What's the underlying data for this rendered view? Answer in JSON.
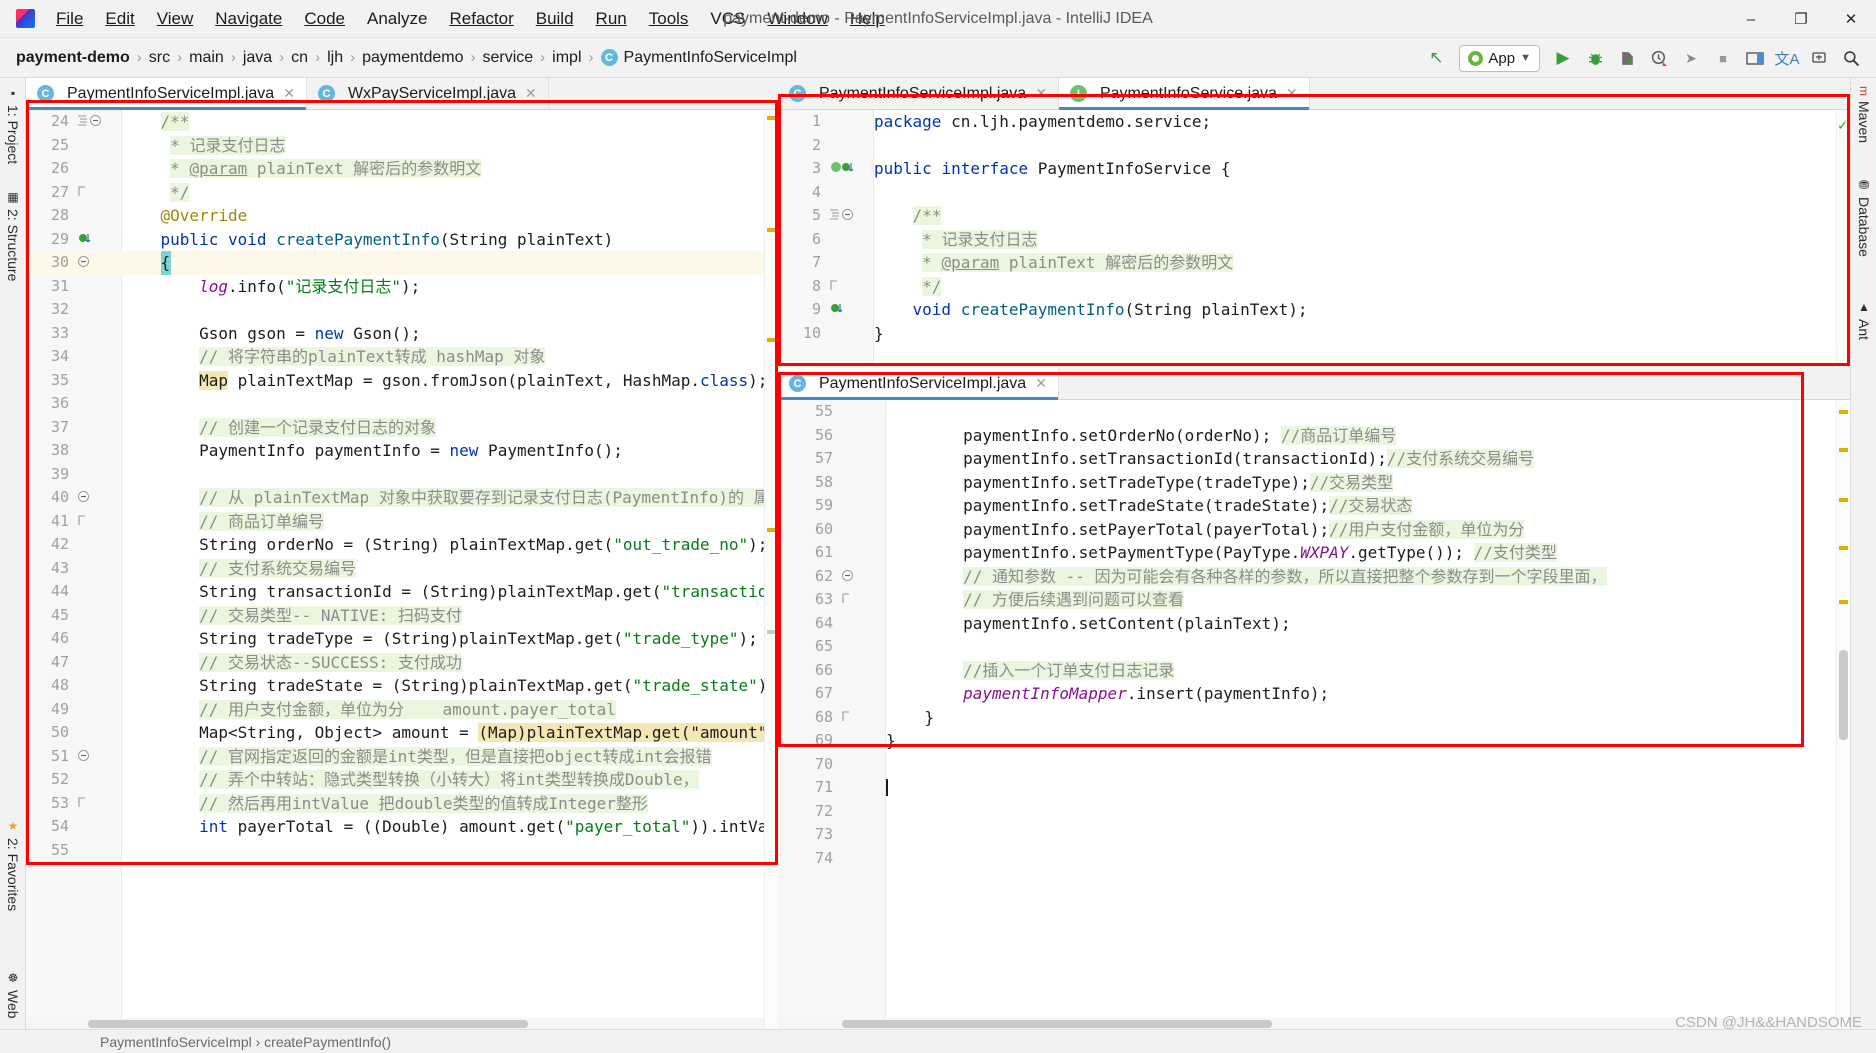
{
  "window": {
    "title": "payment-demo - PaymentInfoServiceImpl.java - IntelliJ IDEA",
    "minimize": "–",
    "maximize": "❐",
    "close": "✕"
  },
  "menu": [
    {
      "label": "File"
    },
    {
      "label": "Edit"
    },
    {
      "label": "View"
    },
    {
      "label": "Navigate"
    },
    {
      "label": "Code"
    },
    {
      "label": "Analyze"
    },
    {
      "label": "Refactor"
    },
    {
      "label": "Build"
    },
    {
      "label": "Run"
    },
    {
      "label": "Tools"
    },
    {
      "label": "VCS"
    },
    {
      "label": "Window"
    },
    {
      "label": "Help"
    }
  ],
  "breadcrumb": {
    "items": [
      "payment-demo",
      "src",
      "main",
      "java",
      "cn",
      "ljh",
      "paymentdemo",
      "service",
      "impl"
    ],
    "final": "PaymentInfoServiceImpl",
    "final_badge": "C",
    "separator": "›"
  },
  "toolbar": {
    "back_arrow": "↖",
    "run_config": "App",
    "dropdown_caret": "▼",
    "run": "▶",
    "debug": "debug-icon",
    "coverage": "coverage-icon",
    "profile": "profile-icon",
    "attach": "➤",
    "stop": "■",
    "layout": "layout-icon",
    "translate": "文A",
    "updates": "updates-icon",
    "search": "⌕"
  },
  "left_strip": [
    {
      "label": "1: Project",
      "icon": "■"
    },
    {
      "label": "2: Structure",
      "icon": "▦"
    },
    {
      "label": "2: Favorites",
      "icon": "★"
    },
    {
      "label": "Web",
      "icon": "☸"
    }
  ],
  "right_strip": [
    {
      "label": "Maven",
      "icon": "m"
    },
    {
      "label": "Database",
      "icon": "⛃"
    },
    {
      "label": "Ant",
      "icon": "▲"
    }
  ],
  "left_editor": {
    "tabs": [
      {
        "label": "PaymentInfoServiceImpl.java",
        "badge": "C",
        "badge_kind": "class",
        "active": true,
        "close": "✕"
      },
      {
        "label": "WxPayServiceImpl.java",
        "badge": "C",
        "badge_kind": "class",
        "active": false,
        "close": "✕"
      }
    ],
    "first_line": 24,
    "lines": [
      {
        "n": 24,
        "indent": 4,
        "segs": [
          {
            "t": "/**",
            "c": "cmt"
          }
        ],
        "fold": "minus",
        "gutter": "struct"
      },
      {
        "n": 25,
        "indent": 5,
        "segs": [
          {
            "t": "* 记录支付日志",
            "c": "cmt"
          }
        ]
      },
      {
        "n": 26,
        "indent": 5,
        "segs": [
          {
            "t": "* ",
            "c": "cmt"
          },
          {
            "t": "@param",
            "c": "cmt ul"
          },
          {
            "t": " plainText 解密后的参数明文",
            "c": "cmt"
          }
        ]
      },
      {
        "n": 27,
        "indent": 5,
        "segs": [
          {
            "t": "*/",
            "c": "cmt"
          }
        ],
        "fold": "end"
      },
      {
        "n": 28,
        "indent": 4,
        "segs": [
          {
            "t": "@Override",
            "c": "ann"
          }
        ]
      },
      {
        "n": 29,
        "indent": 4,
        "segs": [
          {
            "t": "public",
            "c": "kw"
          },
          {
            "t": " ",
            "c": ""
          },
          {
            "t": "void",
            "c": "kw"
          },
          {
            "t": " ",
            "c": ""
          },
          {
            "t": "createPaymentInfo",
            "c": "mth"
          },
          {
            "t": "(String plainText)",
            "c": ""
          }
        ],
        "gutter": "impl"
      },
      {
        "n": 30,
        "indent": 4,
        "segs": [
          {
            "t": "{",
            "c": "blockcaret"
          }
        ],
        "hl": true,
        "fold": "minus"
      },
      {
        "n": 31,
        "indent": 8,
        "segs": [
          {
            "t": "log",
            "c": "fld"
          },
          {
            "t": ".info(",
            "c": ""
          },
          {
            "t": "\"记录支付日志\"",
            "c": "str"
          },
          {
            "t": ");",
            "c": ""
          }
        ]
      },
      {
        "n": 32,
        "indent": 0,
        "segs": []
      },
      {
        "n": 33,
        "indent": 8,
        "segs": [
          {
            "t": "Gson gson = ",
            "c": ""
          },
          {
            "t": "new",
            "c": "kw"
          },
          {
            "t": " Gson();",
            "c": ""
          }
        ]
      },
      {
        "n": 34,
        "indent": 8,
        "segs": [
          {
            "t": "// 将字符串的plainText转成 hashMap 对象",
            "c": "cmt"
          }
        ]
      },
      {
        "n": 35,
        "indent": 8,
        "segs": [
          {
            "t": "Map",
            "c": "hl-y"
          },
          {
            "t": " plainTextMap = gson.fromJson(plainText, HashMap.",
            "c": ""
          },
          {
            "t": "class",
            "c": "kw"
          },
          {
            "t": ");",
            "c": ""
          }
        ]
      },
      {
        "n": 36,
        "indent": 0,
        "segs": []
      },
      {
        "n": 37,
        "indent": 8,
        "segs": [
          {
            "t": "// 创建一个记录支付日志的对象",
            "c": "cmt"
          }
        ]
      },
      {
        "n": 38,
        "indent": 8,
        "segs": [
          {
            "t": "PaymentInfo paymentInfo = ",
            "c": ""
          },
          {
            "t": "new",
            "c": "kw"
          },
          {
            "t": " PaymentInfo();",
            "c": ""
          }
        ]
      },
      {
        "n": 39,
        "indent": 0,
        "segs": []
      },
      {
        "n": 40,
        "indent": 8,
        "segs": [
          {
            "t": "// 从 plainTextMap 对象中获取要存到记录支付日志(PaymentInfo)的 属性字段",
            "c": "cmt"
          }
        ],
        "fold": "minus"
      },
      {
        "n": 41,
        "indent": 8,
        "segs": [
          {
            "t": "// 商品订单编号",
            "c": "cmt"
          }
        ],
        "fold": "end"
      },
      {
        "n": 42,
        "indent": 8,
        "segs": [
          {
            "t": "String orderNo = (String) plainTextMap.get(",
            "c": ""
          },
          {
            "t": "\"out_trade_no\"",
            "c": "str"
          },
          {
            "t": ");",
            "c": ""
          }
        ]
      },
      {
        "n": 43,
        "indent": 8,
        "segs": [
          {
            "t": "// 支付系统交易编号",
            "c": "cmt"
          }
        ]
      },
      {
        "n": 44,
        "indent": 8,
        "segs": [
          {
            "t": "String transactionId = (String)plainTextMap.get(",
            "c": ""
          },
          {
            "t": "\"transaction_id\"",
            "c": "str"
          },
          {
            "t": ");",
            "c": ""
          }
        ]
      },
      {
        "n": 45,
        "indent": 8,
        "segs": [
          {
            "t": "// 交易类型-- NATIVE: 扫码支付",
            "c": "cmt"
          }
        ]
      },
      {
        "n": 46,
        "indent": 8,
        "segs": [
          {
            "t": "String tradeType = (String)plainTextMap.get(",
            "c": ""
          },
          {
            "t": "\"trade_type\"",
            "c": "str"
          },
          {
            "t": ");",
            "c": ""
          }
        ]
      },
      {
        "n": 47,
        "indent": 8,
        "segs": [
          {
            "t": "// 交易状态--SUCCESS: 支付成功",
            "c": "cmt"
          }
        ]
      },
      {
        "n": 48,
        "indent": 8,
        "segs": [
          {
            "t": "String tradeState = (String)plainTextMap.get(",
            "c": ""
          },
          {
            "t": "\"trade_state\"",
            "c": "str"
          },
          {
            "t": ");",
            "c": ""
          }
        ]
      },
      {
        "n": 49,
        "indent": 8,
        "segs": [
          {
            "t": "// 用户支付金额，单位为分    amount.payer_total",
            "c": "cmt"
          }
        ]
      },
      {
        "n": 50,
        "indent": 8,
        "segs": [
          {
            "t": "Map<String, Object> amount = ",
            "c": ""
          },
          {
            "t": "(Map)plainTextMap.get(\"amount\");",
            "c": "hl-y"
          }
        ]
      },
      {
        "n": 51,
        "indent": 8,
        "segs": [
          {
            "t": "// 官网指定返回的金额是int类型，但是直接把object转成int会报错",
            "c": "cmt"
          }
        ],
        "fold": "minus"
      },
      {
        "n": 52,
        "indent": 8,
        "segs": [
          {
            "t": "// 弄个中转站：隐式类型转换（小转大）将int类型转换成Double，",
            "c": "cmt"
          }
        ]
      },
      {
        "n": 53,
        "indent": 8,
        "segs": [
          {
            "t": "// 然后再用intValue 把double类型的值转成Integer整形",
            "c": "cmt"
          }
        ],
        "fold": "end"
      },
      {
        "n": 54,
        "indent": 8,
        "segs": [
          {
            "t": "int",
            "c": "kw"
          },
          {
            "t": " payerTotal = ((Double) amount.get(",
            "c": ""
          },
          {
            "t": "\"payer_total\"",
            "c": "str"
          },
          {
            "t": ")).intValue();",
            "c": ""
          }
        ]
      },
      {
        "n": 55,
        "indent": 0,
        "segs": []
      }
    ],
    "status_crumb": "PaymentInfoServiceImpl › createPaymentInfo()"
  },
  "right_top_editor": {
    "tabs": [
      {
        "label": "PaymentInfoServiceImpl.java",
        "badge": "C",
        "badge_kind": "class",
        "active": false,
        "close": "✕"
      },
      {
        "label": "PaymentInfoService.java",
        "badge": "I",
        "badge_kind": "interface",
        "active": true,
        "close": "✕"
      }
    ],
    "check_icon": "✓",
    "lines": [
      {
        "n": 1,
        "indent": 0,
        "segs": [
          {
            "t": "package",
            "c": "kw"
          },
          {
            "t": " cn.ljh.paymentdemo.service;",
            "c": ""
          }
        ]
      },
      {
        "n": 2,
        "indent": 0,
        "segs": []
      },
      {
        "n": 3,
        "indent": 0,
        "segs": [
          {
            "t": "public",
            "c": "kw"
          },
          {
            "t": " ",
            "c": ""
          },
          {
            "t": "interface",
            "c": "kw"
          },
          {
            "t": " PaymentInfoService {",
            "c": ""
          }
        ],
        "gutter": "iface"
      },
      {
        "n": 4,
        "indent": 0,
        "segs": []
      },
      {
        "n": 5,
        "indent": 4,
        "segs": [
          {
            "t": "/**",
            "c": "cmt"
          }
        ],
        "fold": "minus",
        "gutter": "struct"
      },
      {
        "n": 6,
        "indent": 5,
        "segs": [
          {
            "t": "* 记录支付日志",
            "c": "cmt"
          }
        ]
      },
      {
        "n": 7,
        "indent": 5,
        "segs": [
          {
            "t": "* ",
            "c": "cmt"
          },
          {
            "t": "@param",
            "c": "cmt ul"
          },
          {
            "t": " plainText 解密后的参数明文",
            "c": "cmt"
          }
        ]
      },
      {
        "n": 8,
        "indent": 5,
        "segs": [
          {
            "t": "*/",
            "c": "cmt"
          }
        ],
        "fold": "end"
      },
      {
        "n": 9,
        "indent": 4,
        "segs": [
          {
            "t": "void",
            "c": "kw"
          },
          {
            "t": " ",
            "c": ""
          },
          {
            "t": "createPaymentInfo",
            "c": "mth"
          },
          {
            "t": "(String plainText);",
            "c": ""
          }
        ],
        "gutter": "impl"
      },
      {
        "n": 10,
        "indent": 0,
        "segs": [
          {
            "t": "}",
            "c": ""
          }
        ]
      }
    ]
  },
  "right_bottom_editor": {
    "tabs": [
      {
        "label": "PaymentInfoServiceImpl.java",
        "badge": "C",
        "badge_kind": "class",
        "active": true,
        "close": "✕"
      }
    ],
    "lines": [
      {
        "n": 55,
        "indent": 0,
        "segs": []
      },
      {
        "n": 56,
        "indent": 8,
        "segs": [
          {
            "t": "paymentInfo.setOrderNo(orderNo); ",
            "c": ""
          },
          {
            "t": "//商品订单编号",
            "c": "cmt"
          }
        ]
      },
      {
        "n": 57,
        "indent": 8,
        "segs": [
          {
            "t": "paymentInfo.setTransactionId(transactionId);",
            "c": ""
          },
          {
            "t": "//支付系统交易编号",
            "c": "cmt"
          }
        ]
      },
      {
        "n": 58,
        "indent": 8,
        "segs": [
          {
            "t": "paymentInfo.setTradeType(tradeType);",
            "c": ""
          },
          {
            "t": "//交易类型",
            "c": "cmt"
          }
        ]
      },
      {
        "n": 59,
        "indent": 8,
        "segs": [
          {
            "t": "paymentInfo.setTradeState(tradeState);",
            "c": ""
          },
          {
            "t": "//交易状态",
            "c": "cmt"
          }
        ]
      },
      {
        "n": 60,
        "indent": 8,
        "segs": [
          {
            "t": "paymentInfo.setPayerTotal(payerTotal);",
            "c": ""
          },
          {
            "t": "//用户支付金额，单位为分",
            "c": "cmt"
          }
        ]
      },
      {
        "n": 61,
        "indent": 8,
        "segs": [
          {
            "t": "paymentInfo.setPaymentType(PayType.",
            "c": ""
          },
          {
            "t": "WXPAY",
            "c": "fld"
          },
          {
            "t": ".getType()); ",
            "c": ""
          },
          {
            "t": "//支付类型",
            "c": "cmt"
          }
        ]
      },
      {
        "n": 62,
        "indent": 8,
        "segs": [
          {
            "t": "// 通知参数 -- 因为可能会有各种各样的参数，所以直接把整个参数存到一个字段里面，",
            "c": "cmt"
          }
        ],
        "fold": "minus"
      },
      {
        "n": 63,
        "indent": 8,
        "segs": [
          {
            "t": "// 方便后续遇到问题可以查看",
            "c": "cmt"
          }
        ],
        "fold": "end"
      },
      {
        "n": 64,
        "indent": 8,
        "segs": [
          {
            "t": "paymentInfo.setContent(plainText);",
            "c": ""
          }
        ]
      },
      {
        "n": 65,
        "indent": 0,
        "segs": []
      },
      {
        "n": 66,
        "indent": 8,
        "segs": [
          {
            "t": "//插入一个订单支付日志记录",
            "c": "cmt"
          }
        ]
      },
      {
        "n": 67,
        "indent": 8,
        "segs": [
          {
            "t": "paymentInfoMapper",
            "c": "fld"
          },
          {
            "t": ".insert(paymentInfo);",
            "c": ""
          }
        ]
      },
      {
        "n": 68,
        "indent": 4,
        "segs": [
          {
            "t": "}",
            "c": ""
          }
        ],
        "fold": "end"
      },
      {
        "n": 69,
        "indent": 0,
        "segs": [
          {
            "t": "}",
            "c": ""
          }
        ]
      },
      {
        "n": 70,
        "indent": 0,
        "segs": []
      },
      {
        "n": 71,
        "indent": 0,
        "segs": [
          {
            "t": "",
            "c": "caret"
          }
        ],
        "caret": true
      },
      {
        "n": 72,
        "indent": 0,
        "segs": []
      },
      {
        "n": 73,
        "indent": 0,
        "segs": []
      },
      {
        "n": 74,
        "indent": 0,
        "segs": []
      }
    ]
  },
  "watermark": "CSDN @JH&&HANDSOME"
}
